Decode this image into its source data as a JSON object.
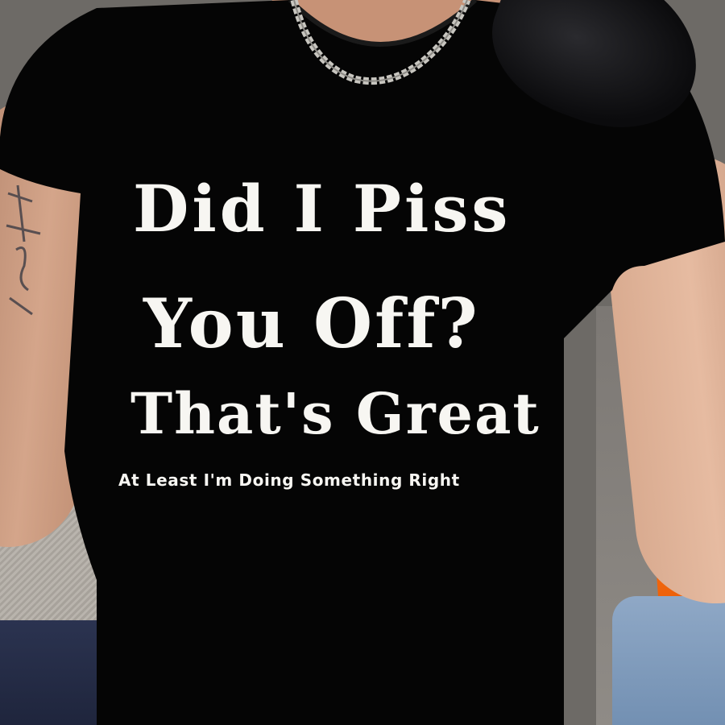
{
  "shirt": {
    "color": "#050505",
    "print_color": "#f7f6f2",
    "print_lines": [
      "Did I Piss",
      "You Off?",
      "That's Great",
      "At Least I'm Doing Something Right"
    ]
  },
  "colors": {
    "skin": "#d4a58a",
    "orange_object": "#f06a0e",
    "jeans": "#7d98ba",
    "chain": "#c8c6c0"
  }
}
